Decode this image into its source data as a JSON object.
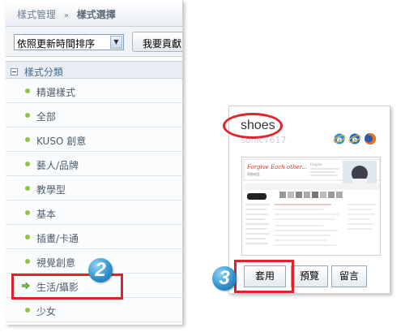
{
  "breadcrumb": {
    "parent": "樣式管理",
    "separator": "»",
    "current": "樣式選擇"
  },
  "toolbar": {
    "sort_value": "依照更新時間排序",
    "contribute_label": "我要貢獻"
  },
  "categories": {
    "header": "樣式分類",
    "items": [
      {
        "label": "精選樣式"
      },
      {
        "label": "全部"
      },
      {
        "label": "KUSO 創意"
      },
      {
        "label": "藝人/品牌"
      },
      {
        "label": "教學型"
      },
      {
        "label": "基本"
      },
      {
        "label": "插畫/卡通"
      },
      {
        "label": "視覺創意"
      },
      {
        "label": "生活/攝影",
        "selected": true
      },
      {
        "label": "少女"
      }
    ]
  },
  "steps": {
    "step2": "2",
    "step3": "3"
  },
  "theme_card": {
    "name": "shoes",
    "author": "sonic7617",
    "browser_icons": [
      "ie6-icon",
      "ie7-icon",
      "firefox-icon"
    ],
    "thumbnail": {
      "banner_title": "Forgive Each other...",
      "banner_title2": "Forgive",
      "banner_sub": "原諒彼此"
    },
    "buttons": {
      "apply": "套用",
      "preview": "預覽",
      "message": "留言"
    }
  },
  "colors": {
    "highlight": "#e2222a",
    "badge": "#2e8dc8",
    "dot": "#8dc63f"
  }
}
